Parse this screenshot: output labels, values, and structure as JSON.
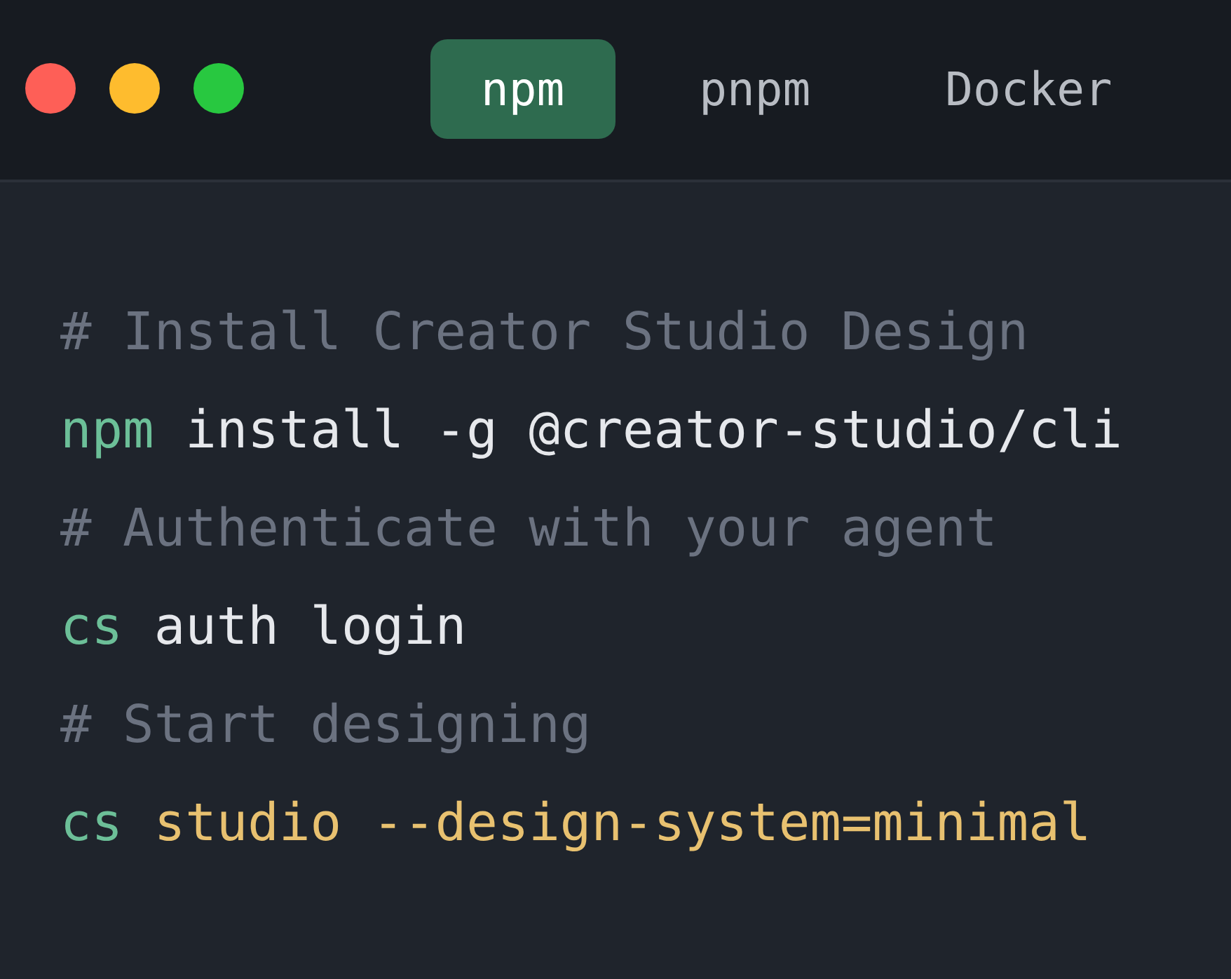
{
  "window_controls": [
    {
      "color": "#fe5f57"
    },
    {
      "color": "#febc2e"
    },
    {
      "color": "#28c840"
    }
  ],
  "tabs": [
    {
      "label": "npm",
      "selected": true
    },
    {
      "label": "pnpm",
      "selected": false
    },
    {
      "label": "Docker",
      "selected": false
    }
  ],
  "code_lines": [
    {
      "tokens": [
        {
          "kind": "comment",
          "text": "# Install Creator Studio Design"
        }
      ]
    },
    {
      "tokens": [
        {
          "kind": "command",
          "text": "npm"
        },
        {
          "kind": "plain",
          "text": " install -g @creator-studio/cli"
        }
      ]
    },
    {
      "tokens": [
        {
          "kind": "comment",
          "text": "# Authenticate with your agent"
        }
      ]
    },
    {
      "tokens": [
        {
          "kind": "command",
          "text": "cs"
        },
        {
          "kind": "plain",
          "text": " auth login"
        }
      ]
    },
    {
      "tokens": [
        {
          "kind": "comment",
          "text": "# Start designing"
        }
      ]
    },
    {
      "tokens": [
        {
          "kind": "command",
          "text": "cs"
        },
        {
          "kind": "string",
          "text": " studio --design-system=minimal"
        }
      ]
    }
  ]
}
